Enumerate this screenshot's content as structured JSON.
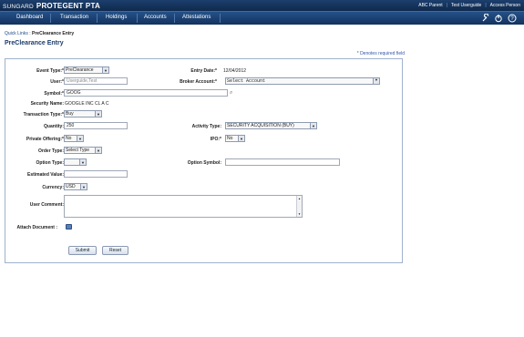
{
  "header": {
    "brand_prefix": "SUNGARD",
    "brand_name": "PROTEGENT PTA",
    "user_links": [
      "ABC Parent",
      "Test Userguide",
      "Access Person"
    ]
  },
  "nav": {
    "tabs": [
      "Dashboard",
      "Transaction",
      "Holdings",
      "Accounts",
      "Attestations"
    ],
    "icons": [
      "wrench-icon",
      "power-icon",
      "help-icon"
    ]
  },
  "breadcrumb": {
    "link": "Quick Links",
    "separator": ":",
    "current": "PreClearance Entry"
  },
  "page": {
    "title": "PreClearance Entry",
    "required_note": "* Denotes required field"
  },
  "form": {
    "event_type": {
      "label": "Event Type:*",
      "value": "PreClearance"
    },
    "entry_date": {
      "label": "Entry Date:*",
      "value": "12/04/2012"
    },
    "user": {
      "label": "User:*",
      "placeholder": "Userguide,Test"
    },
    "broker_account": {
      "label": "Broker Account:*",
      "value": "Select Account"
    },
    "symbol": {
      "label": "Symbol:*",
      "value": "GOOG"
    },
    "security_name": {
      "label": "Security Name:",
      "value": "GOOGLE INC CL A C"
    },
    "transaction_type": {
      "label": "Transaction Type:*",
      "value": "Buy"
    },
    "quantity": {
      "label": "Quantity:",
      "value": "250"
    },
    "activity_type": {
      "label": "Activity Type:",
      "value": "SECURITY ACQUISITION (BUY)"
    },
    "private_offering": {
      "label": "Private Offering:*",
      "value": "No"
    },
    "ipo": {
      "label": "IPO:*",
      "value": "No"
    },
    "order_type": {
      "label": "Order Type:",
      "value": "Select Type"
    },
    "option_type": {
      "label": "Option Type:",
      "value": ""
    },
    "option_symbol": {
      "label": "Option Symbol:",
      "value": ""
    },
    "estimated_value": {
      "label": "Estimated Value:",
      "value": ""
    },
    "currency": {
      "label": "Currency:",
      "value": "USD"
    },
    "user_comment": {
      "label": "User Comment:",
      "value": ""
    },
    "attach_document": {
      "label": "Attach Document :"
    }
  },
  "buttons": {
    "submit": "Submit",
    "reset": "Reset"
  }
}
